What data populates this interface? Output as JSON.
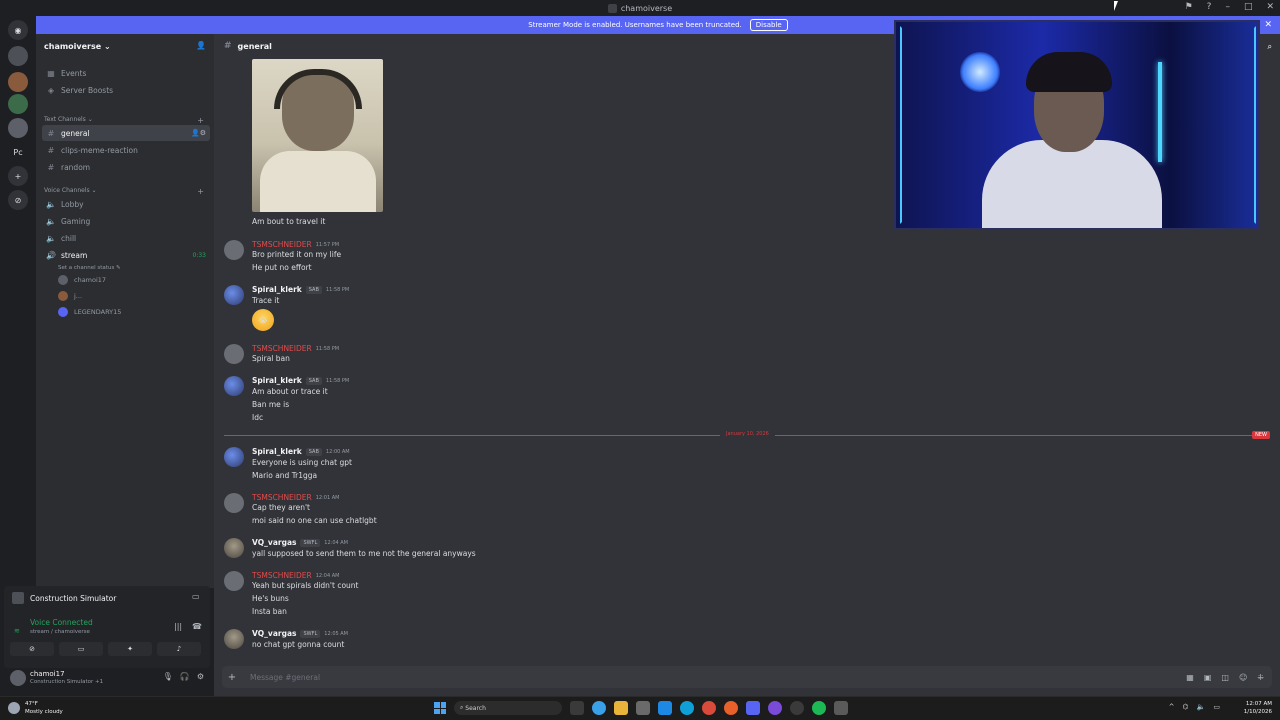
{
  "window": {
    "title": "chamoiverse"
  },
  "banner": {
    "text": "Streamer Mode is enabled. Usernames have been truncated.",
    "disable_label": "Disable"
  },
  "rail": {
    "pc_label": "Pc"
  },
  "sidebar": {
    "guild_name": "chamoiverse ⌄",
    "top_items": [
      {
        "label": "Events",
        "icon": "calendar-icon"
      },
      {
        "label": "Server Boosts",
        "icon": "boost-icon"
      }
    ],
    "text_category": "Text Channels ⌄",
    "text_channels": [
      "general",
      "clips-meme-reaction",
      "random"
    ],
    "voice_category": "Voice Channels ⌄",
    "voice_channels": [
      "Lobby",
      "Gaming",
      "chill",
      "stream"
    ],
    "stream_timer": "0:33",
    "stream_status": "Set a channel status ✎",
    "voice_users": [
      "chamoi17",
      "j...",
      "LEGENDARY15"
    ]
  },
  "activity": {
    "game": "Construction Simulator",
    "voice_status": "Voice Connected",
    "voice_sub": "stream / chamoiverse"
  },
  "user": {
    "name": "chamoi17",
    "status": "Construction Simulator +1"
  },
  "channel": {
    "name": "general",
    "composer_placeholder": "Message #general"
  },
  "messages": {
    "m0_line": "Am bout to travel it",
    "m1": {
      "author": "TSMSCHNEIDER",
      "time": "11:57 PM",
      "lines": [
        "Bro printed it on my life",
        "He put no effort"
      ]
    },
    "m2": {
      "author": "Spiral_klerk",
      "tag": "SAB",
      "time": "11:58 PM",
      "lines": [
        "Trace it"
      ],
      "emoji": "😭"
    },
    "m3": {
      "author": "TSMSCHNEIDER",
      "time": "11:58 PM",
      "lines": [
        "Spiral ban"
      ]
    },
    "m4": {
      "author": "Spiral_klerk",
      "tag": "SAB",
      "time": "11:58 PM",
      "lines": [
        "Am about or trace it",
        "Ban me is",
        "Idc"
      ]
    },
    "divider_date": "January 10, 2026",
    "divider_new": "NEW",
    "m5": {
      "author": "Spiral_klerk",
      "tag": "SAB",
      "time": "12:00 AM",
      "lines": [
        "Everyone is using chat gpt",
        "Mario and Tr1gga"
      ]
    },
    "m6": {
      "author": "TSMSCHNEIDER",
      "time": "12:01 AM",
      "lines": [
        "Cap they aren't",
        "moi said no one can use chatlgbt"
      ]
    },
    "m7": {
      "author": "VQ_vargas",
      "tag": "SWFL",
      "time": "12:04 AM",
      "lines": [
        "yall supposed to send them to me not the general anyways"
      ]
    },
    "m8": {
      "author": "TSMSCHNEIDER",
      "time": "12:04 AM",
      "lines": [
        "Yeah but spirals didn't count",
        "He's buns",
        "Insta ban"
      ]
    },
    "m9": {
      "author": "VQ_vargas",
      "tag": "SWFL",
      "time": "12:05 AM",
      "lines": [
        "no chat gpt gonna count"
      ]
    }
  },
  "taskbar": {
    "temp": "47°F",
    "weather": "Mostly cloudy",
    "search_label": "Search",
    "time": "12:07 AM",
    "date": "1/10/2026"
  }
}
